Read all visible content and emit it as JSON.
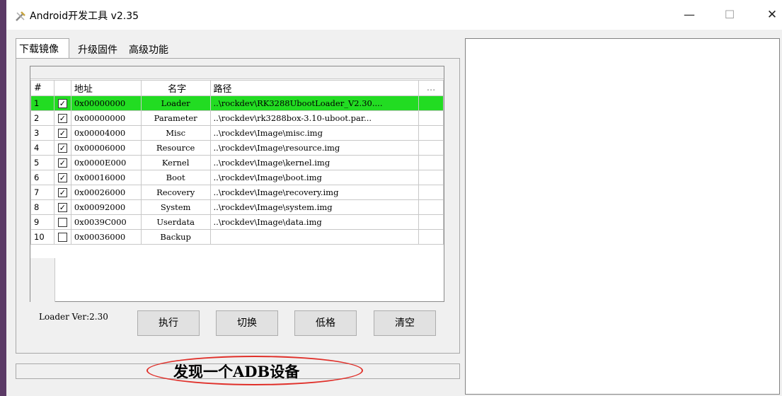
{
  "window": {
    "title": "Android开发工具 v2.35",
    "minimize": "—",
    "maximize": "☐",
    "close": "✕"
  },
  "tabs": [
    {
      "label": "下载镜像",
      "active": true
    },
    {
      "label": "升级固件",
      "active": false
    },
    {
      "label": "高级功能",
      "active": false
    }
  ],
  "table": {
    "headers": {
      "num": "#",
      "check": "",
      "address": "地址",
      "name": "名字",
      "path": "路径",
      "more": "..."
    },
    "rows": [
      {
        "num": "1",
        "checked": true,
        "address": "0x00000000",
        "name": "Loader",
        "path": "..\\rockdev\\RK3288UbootLoader_V2.30....",
        "selected": true
      },
      {
        "num": "2",
        "checked": true,
        "address": "0x00000000",
        "name": "Parameter",
        "path": "..\\rockdev\\rk3288box-3.10-uboot.par..."
      },
      {
        "num": "3",
        "checked": true,
        "address": "0x00004000",
        "name": "Misc",
        "path": "..\\rockdev\\Image\\misc.img"
      },
      {
        "num": "4",
        "checked": true,
        "address": "0x00006000",
        "name": "Resource",
        "path": "..\\rockdev\\Image\\resource.img"
      },
      {
        "num": "5",
        "checked": true,
        "address": "0x0000E000",
        "name": "Kernel",
        "path": "..\\rockdev\\Image\\kernel.img"
      },
      {
        "num": "6",
        "checked": true,
        "address": "0x00016000",
        "name": "Boot",
        "path": "..\\rockdev\\Image\\boot.img"
      },
      {
        "num": "7",
        "checked": true,
        "address": "0x00026000",
        "name": "Recovery",
        "path": "..\\rockdev\\Image\\recovery.img"
      },
      {
        "num": "8",
        "checked": true,
        "address": "0x00092000",
        "name": "System",
        "path": "..\\rockdev\\Image\\system.img"
      },
      {
        "num": "9",
        "checked": false,
        "address": "0x0039C000",
        "name": "Userdata",
        "path": "..\\rockdev\\Image\\data.img"
      },
      {
        "num": "10",
        "checked": false,
        "address": "0x00036000",
        "name": "Backup",
        "path": ""
      }
    ]
  },
  "loader_version": "Loader Ver:2.30",
  "buttons": {
    "execute": "执行",
    "switch": "切换",
    "low_format": "低格",
    "clear": "清空"
  },
  "status": {
    "text": "发现一个ADB设备",
    "highlight_color": "#e0302a"
  },
  "colors": {
    "selected_row": "#22dc22"
  }
}
